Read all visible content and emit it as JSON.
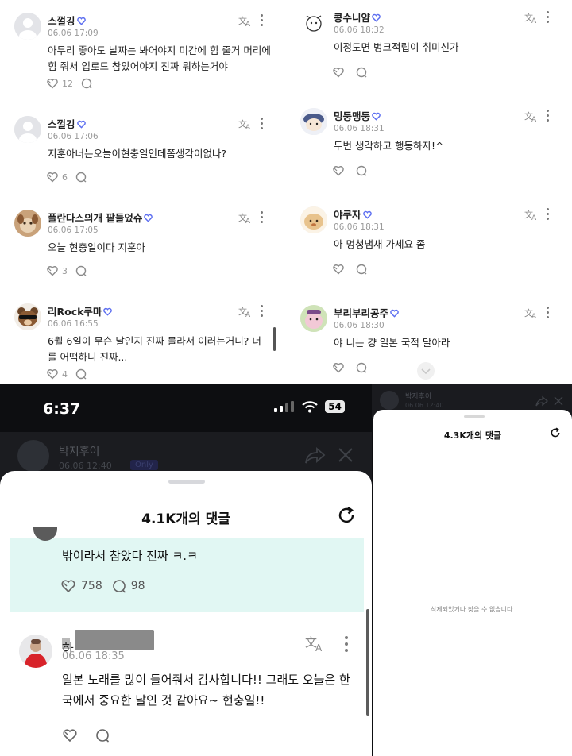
{
  "grid": {
    "left": [
      {
        "name": "스껄깅",
        "date": "06.06 17:09",
        "text": "아무리 좋아도 날짜는 봐어야지 미간에 힘 줄거 머리에 힘 줘서 업로드 참았어야지 진짜 뭐하는거야",
        "likes": "12"
      },
      {
        "name": "스껄깅",
        "date": "06.06 17:06",
        "text": "지훈아너는오늘이현충일인데쫌생각이없나?",
        "likes": "6"
      },
      {
        "name": "플란다스의개 팥들었슈",
        "date": "06.06 17:05",
        "text": "오늘 현충일이다 지훈아",
        "likes": "3"
      },
      {
        "name": "리Rock쿠마",
        "date": "06.06 16:55",
        "text": "6월 6일이 무슨 날인지 진짜 몰라서 이러는거니? 너를 어떡하니 진짜...",
        "likes": "4"
      }
    ],
    "right": [
      {
        "name": "콩수니얌",
        "date": "06.06 18:32",
        "text": "이정도면 벙크적립이 취미신가"
      },
      {
        "name": "밍둥맹둥",
        "date": "06.06 18:31",
        "text": "두번 생각하고 행동하자!^"
      },
      {
        "name": "야쿠자",
        "date": "06.06 18:31",
        "text": "아 멍청냄새 가세요 좀"
      },
      {
        "name": "부리부리공주",
        "date": "06.06 18:30",
        "text": "야 니는 걍 일본 국적 달아라"
      }
    ]
  },
  "phone": {
    "time": "6:37",
    "battery": "54",
    "post_author": "박지후이",
    "post_date": "06.06 12:40",
    "post_badge": "Only",
    "sheet_title": "4.1K개의 댓글",
    "highlight": {
      "text": "밖이라서 참았다 진짜 ㅋ.ㅋ",
      "likes": "758",
      "replies": "98"
    },
    "comment": {
      "name_initial": "하",
      "date": "06.06 18:35",
      "text": "일본 노래를 많이 들어줘서 감사합니다!! 그래도 오늘은 한국에서 중요한 날인 것 같아요~ 현충일!!"
    }
  },
  "deleted": {
    "author": "박지후이",
    "date": "06.06 12:40",
    "title": "4.3K개의 댓글",
    "message": "삭제되었거나 찾을 수 없습니다."
  },
  "colors": {
    "highlight_bg": "#e1f7f3",
    "badge_blue": "#5b6df0",
    "dark_bg": "#0d0e11"
  }
}
